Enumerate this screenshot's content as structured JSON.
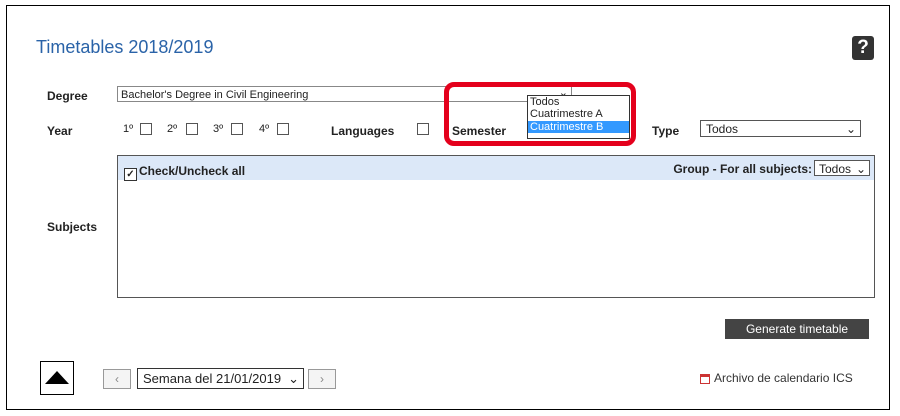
{
  "title": "Timetables 2018/2019",
  "help_label": "?",
  "labels": {
    "degree": "Degree",
    "year": "Year",
    "languages": "Languages",
    "semester": "Semester",
    "type": "Type",
    "subjects": "Subjects"
  },
  "degree": {
    "value": "Bachelor's Degree in Civil Engineering"
  },
  "years": [
    "1º",
    "2º",
    "3º",
    "4º"
  ],
  "semester_dropdown": {
    "options": [
      "Todos",
      "Cuatrimestre A",
      "Cuatrimestre B"
    ],
    "selected": "Cuatrimestre B"
  },
  "type_select": {
    "value": "Todos"
  },
  "subjects": {
    "check_all": "Check/Uncheck all",
    "group_label": "Group - For all subjects:",
    "group_value": "Todos"
  },
  "generate_button": "Generate timetable",
  "week_select": {
    "value": "Semana del 21/01/2019"
  },
  "ics_link": "Archivo de calendario ICS",
  "colors": {
    "accent": "#2a63a8",
    "highlight": "#e4001c",
    "selection": "#3399ff"
  }
}
